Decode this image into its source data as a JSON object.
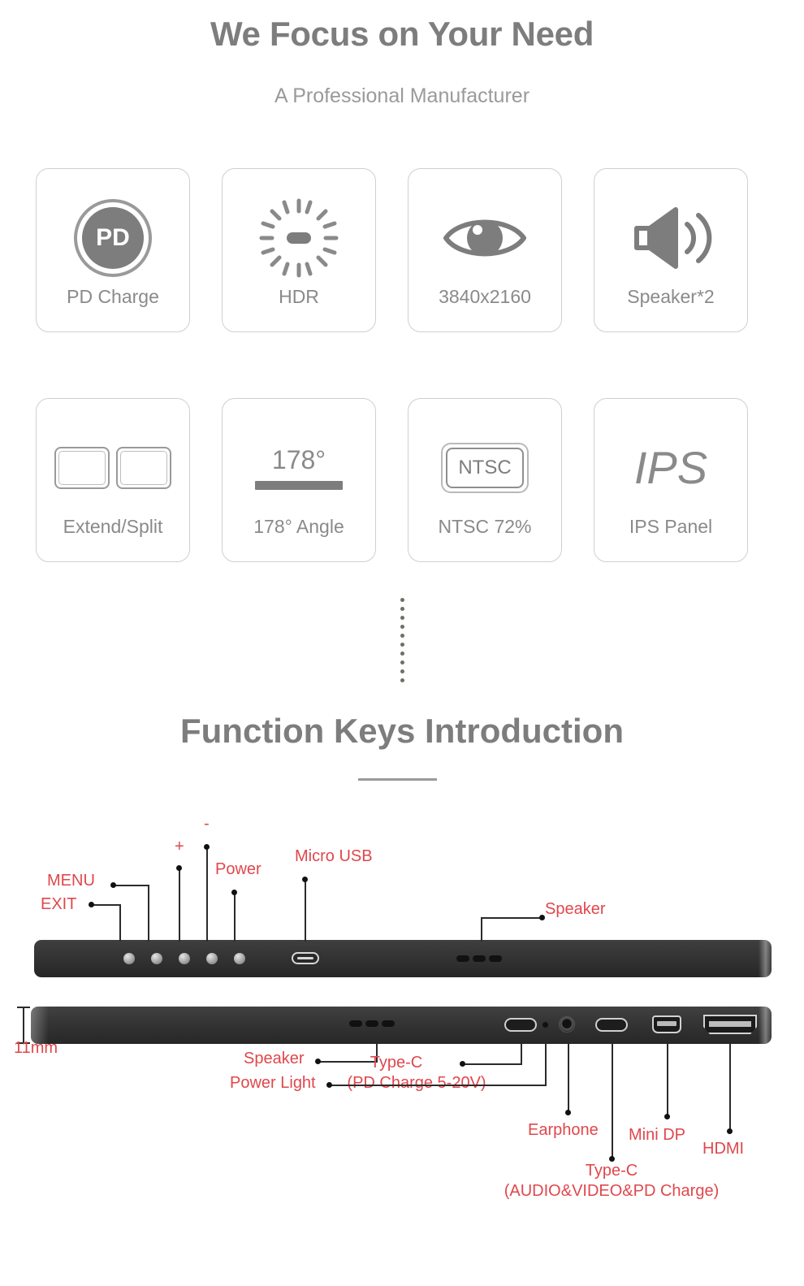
{
  "hero": {
    "title": "We Focus on Your Need",
    "subtitle": "A Professional Manufacturer"
  },
  "features": {
    "row1": [
      {
        "label": "PD Charge",
        "icon": "pd-charge-icon",
        "icon_text": "PD"
      },
      {
        "label": "HDR",
        "icon": "brightness-sun-icon"
      },
      {
        "label": "3840x2160",
        "icon": "eye-icon"
      },
      {
        "label": "Speaker*2",
        "icon": "speaker-icon"
      }
    ],
    "row2": [
      {
        "label": "Extend/Split",
        "icon": "dual-screen-icon"
      },
      {
        "label": "178° Angle",
        "icon": "viewing-angle-icon",
        "icon_text": "178°"
      },
      {
        "label": "NTSC 72%",
        "icon": "ntsc-icon",
        "icon_text": "NTSC"
      },
      {
        "label": "IPS Panel",
        "icon": "ips-icon",
        "icon_text": "IPS"
      }
    ]
  },
  "section2": {
    "title": "Function Keys Introduction"
  },
  "diagram": {
    "top_device": {
      "callouts": [
        {
          "name": "menu",
          "text": "MENU"
        },
        {
          "name": "exit",
          "text": "EXIT"
        },
        {
          "name": "plus",
          "text": "+"
        },
        {
          "name": "minus",
          "text": "-"
        },
        {
          "name": "power",
          "text": "Power"
        },
        {
          "name": "micro-usb",
          "text": "Micro USB"
        },
        {
          "name": "speaker-top",
          "text": "Speaker"
        }
      ]
    },
    "bottom_device": {
      "thickness": "11mm",
      "callouts": [
        {
          "name": "speaker-bottom",
          "text": "Speaker"
        },
        {
          "name": "typec-pd",
          "line1": "Type-C",
          "line2": "(PD Charge 5-20V)"
        },
        {
          "name": "power-light",
          "text": "Power Light"
        },
        {
          "name": "earphone",
          "text": "Earphone"
        },
        {
          "name": "typec-av",
          "line1": "Type-C",
          "line2": "(AUDIO&VIDEO&PD Charge)"
        },
        {
          "name": "mini-dp",
          "text": "Mini DP"
        },
        {
          "name": "hdmi",
          "text": "HDMI"
        }
      ]
    }
  },
  "colors": {
    "callout_red": "#e0474c",
    "heading_gray": "#7d7d7d",
    "card_border": "#cfcfcf",
    "device_black": "#343434"
  }
}
